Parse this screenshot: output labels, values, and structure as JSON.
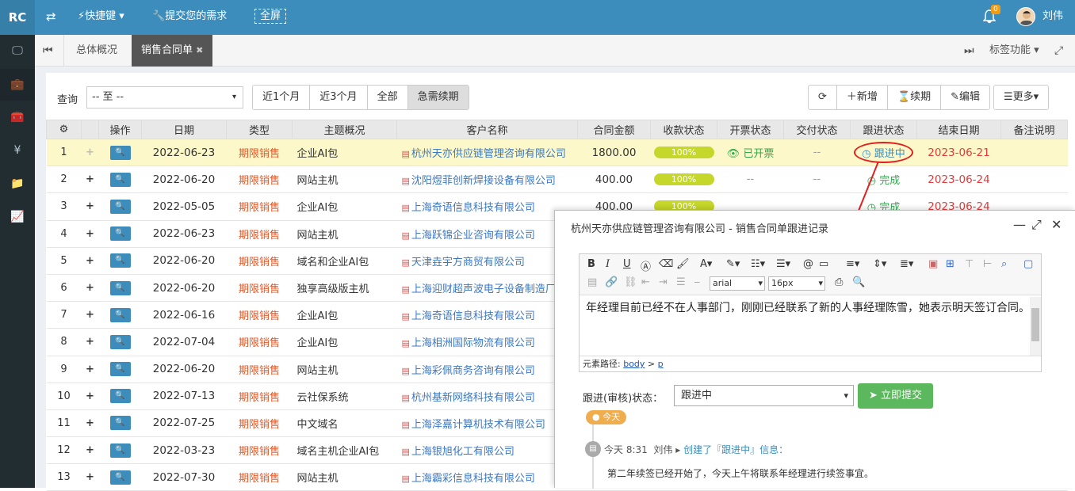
{
  "topbar": {
    "logo": "RC",
    "shortcuts": "快捷键",
    "submit_need": "提交您的需求",
    "fullscreen": "全屏",
    "notify_count": "0",
    "username": "刘伟"
  },
  "tabs": {
    "overview": "总体概况",
    "active": "销售合同单",
    "close": "✖",
    "tag_func": "标签功能"
  },
  "query": {
    "label": "查询",
    "range_value": "-- 至 --",
    "periods": [
      "近1个月",
      "近3个月",
      "全部",
      "急需续期"
    ],
    "active_period": "急需续期"
  },
  "actions": {
    "new": "新增",
    "renew": "续期",
    "edit": "编辑",
    "more": "更多"
  },
  "table": {
    "headers": [
      "",
      "操作",
      "日期",
      "类型",
      "主题概况",
      "客户名称",
      "合同金额",
      "收款状态",
      "开票状态",
      "交付状态",
      "跟进状态",
      "结束日期",
      "备注说明"
    ],
    "rows": [
      {
        "no": "1",
        "plus": "+",
        "date": "2022-06-23",
        "type": "期限销售",
        "subject": "企业AI包",
        "customer": "杭州天亦供应链管理咨询有限公司",
        "amount": "1800.00",
        "collect": "100%",
        "invoice": "已开票",
        "deliver": "--",
        "follow": "跟进中",
        "end": "2023-06-21"
      },
      {
        "no": "2",
        "plus": "+",
        "date": "2022-06-20",
        "type": "期限销售",
        "subject": "网站主机",
        "customer": "沈阳煜菲创新焊接设备有限公司",
        "amount": "400.00",
        "collect": "100%",
        "invoice": "--",
        "deliver": "--",
        "follow": "完成",
        "end": "2023-06-24"
      },
      {
        "no": "3",
        "plus": "+",
        "date": "2022-05-05",
        "type": "期限销售",
        "subject": "企业AI包",
        "customer": "上海奇语信息科技有限公司",
        "amount": "400.00",
        "collect": "100%",
        "invoice": "",
        "deliver": "",
        "follow": "完成",
        "end": "2023-06-24"
      },
      {
        "no": "4",
        "plus": "+",
        "date": "2022-06-23",
        "type": "期限销售",
        "subject": "网站主机",
        "customer": "上海跃锦企业咨询有限公司"
      },
      {
        "no": "5",
        "plus": "+",
        "date": "2022-06-20",
        "type": "期限销售",
        "subject": "域名和企业AI包",
        "customer": "天津垚宇方商贸有限公司"
      },
      {
        "no": "6",
        "plus": "+",
        "date": "2022-06-20",
        "type": "期限销售",
        "subject": "独享高级版主机",
        "customer": "上海迎财超声波电子设备制造厂"
      },
      {
        "no": "7",
        "plus": "+",
        "date": "2022-06-16",
        "type": "期限销售",
        "subject": "企业AI包",
        "customer": "上海奇语信息科技有限公司"
      },
      {
        "no": "8",
        "plus": "+",
        "date": "2022-07-04",
        "type": "期限销售",
        "subject": "企业AI包",
        "customer": "上海相洲国际物流有限公司"
      },
      {
        "no": "9",
        "plus": "+",
        "date": "2022-06-20",
        "type": "期限销售",
        "subject": "网站主机",
        "customer": "上海彩佩商务咨询有限公司"
      },
      {
        "no": "10",
        "plus": "+",
        "date": "2022-07-13",
        "type": "期限销售",
        "subject": "云社保系统",
        "customer": "杭州基新网络科技有限公司"
      },
      {
        "no": "11",
        "plus": "+",
        "date": "2022-07-25",
        "type": "期限销售",
        "subject": "中文域名",
        "customer": "上海泽嘉计算机技术有限公司"
      },
      {
        "no": "12",
        "plus": "+",
        "date": "2022-03-23",
        "type": "期限销售",
        "subject": "域名主机企业AI包",
        "customer": "上海银旭化工有限公司"
      },
      {
        "no": "13",
        "plus": "+",
        "date": "2022-07-30",
        "type": "期限销售",
        "subject": "网站主机",
        "customer": "上海霸彩信息科技有限公司"
      }
    ]
  },
  "dialog": {
    "title": "杭州天亦供应链管理咨询有限公司 - 销售合同单跟进记录",
    "font_name": "arial",
    "font_size": "16px",
    "editor_text": "年经理目前已经不在人事部门，刚刚已经联系了新的人事经理陈雪，她表示明天签订合同。",
    "path_label": "元素路径:",
    "path_body": "body",
    "path_sep": ">",
    "path_p": "p",
    "status_label": "跟进(审核)状态：",
    "status_value": "跟进中",
    "submit": "立即提交",
    "today": "今天",
    "entry_time": "今天 8:31",
    "entry_user": "刘伟",
    "entry_action": "创建了『跟进中』信息：",
    "entry_text": "第二年续签已经开始了，今天上午将联系年经理进行续签事宜。"
  },
  "colors": {
    "topbar": "#3c8dbc",
    "sidebar": "#222d32",
    "highlight_row": "#fcf8c9",
    "type_text": "#e05a2a",
    "customer_link": "#3c78c3",
    "progress": "#c5d72a",
    "done": "#2eab4a",
    "end_date": "#e03c3c",
    "submit_button": "#5cb85c"
  }
}
